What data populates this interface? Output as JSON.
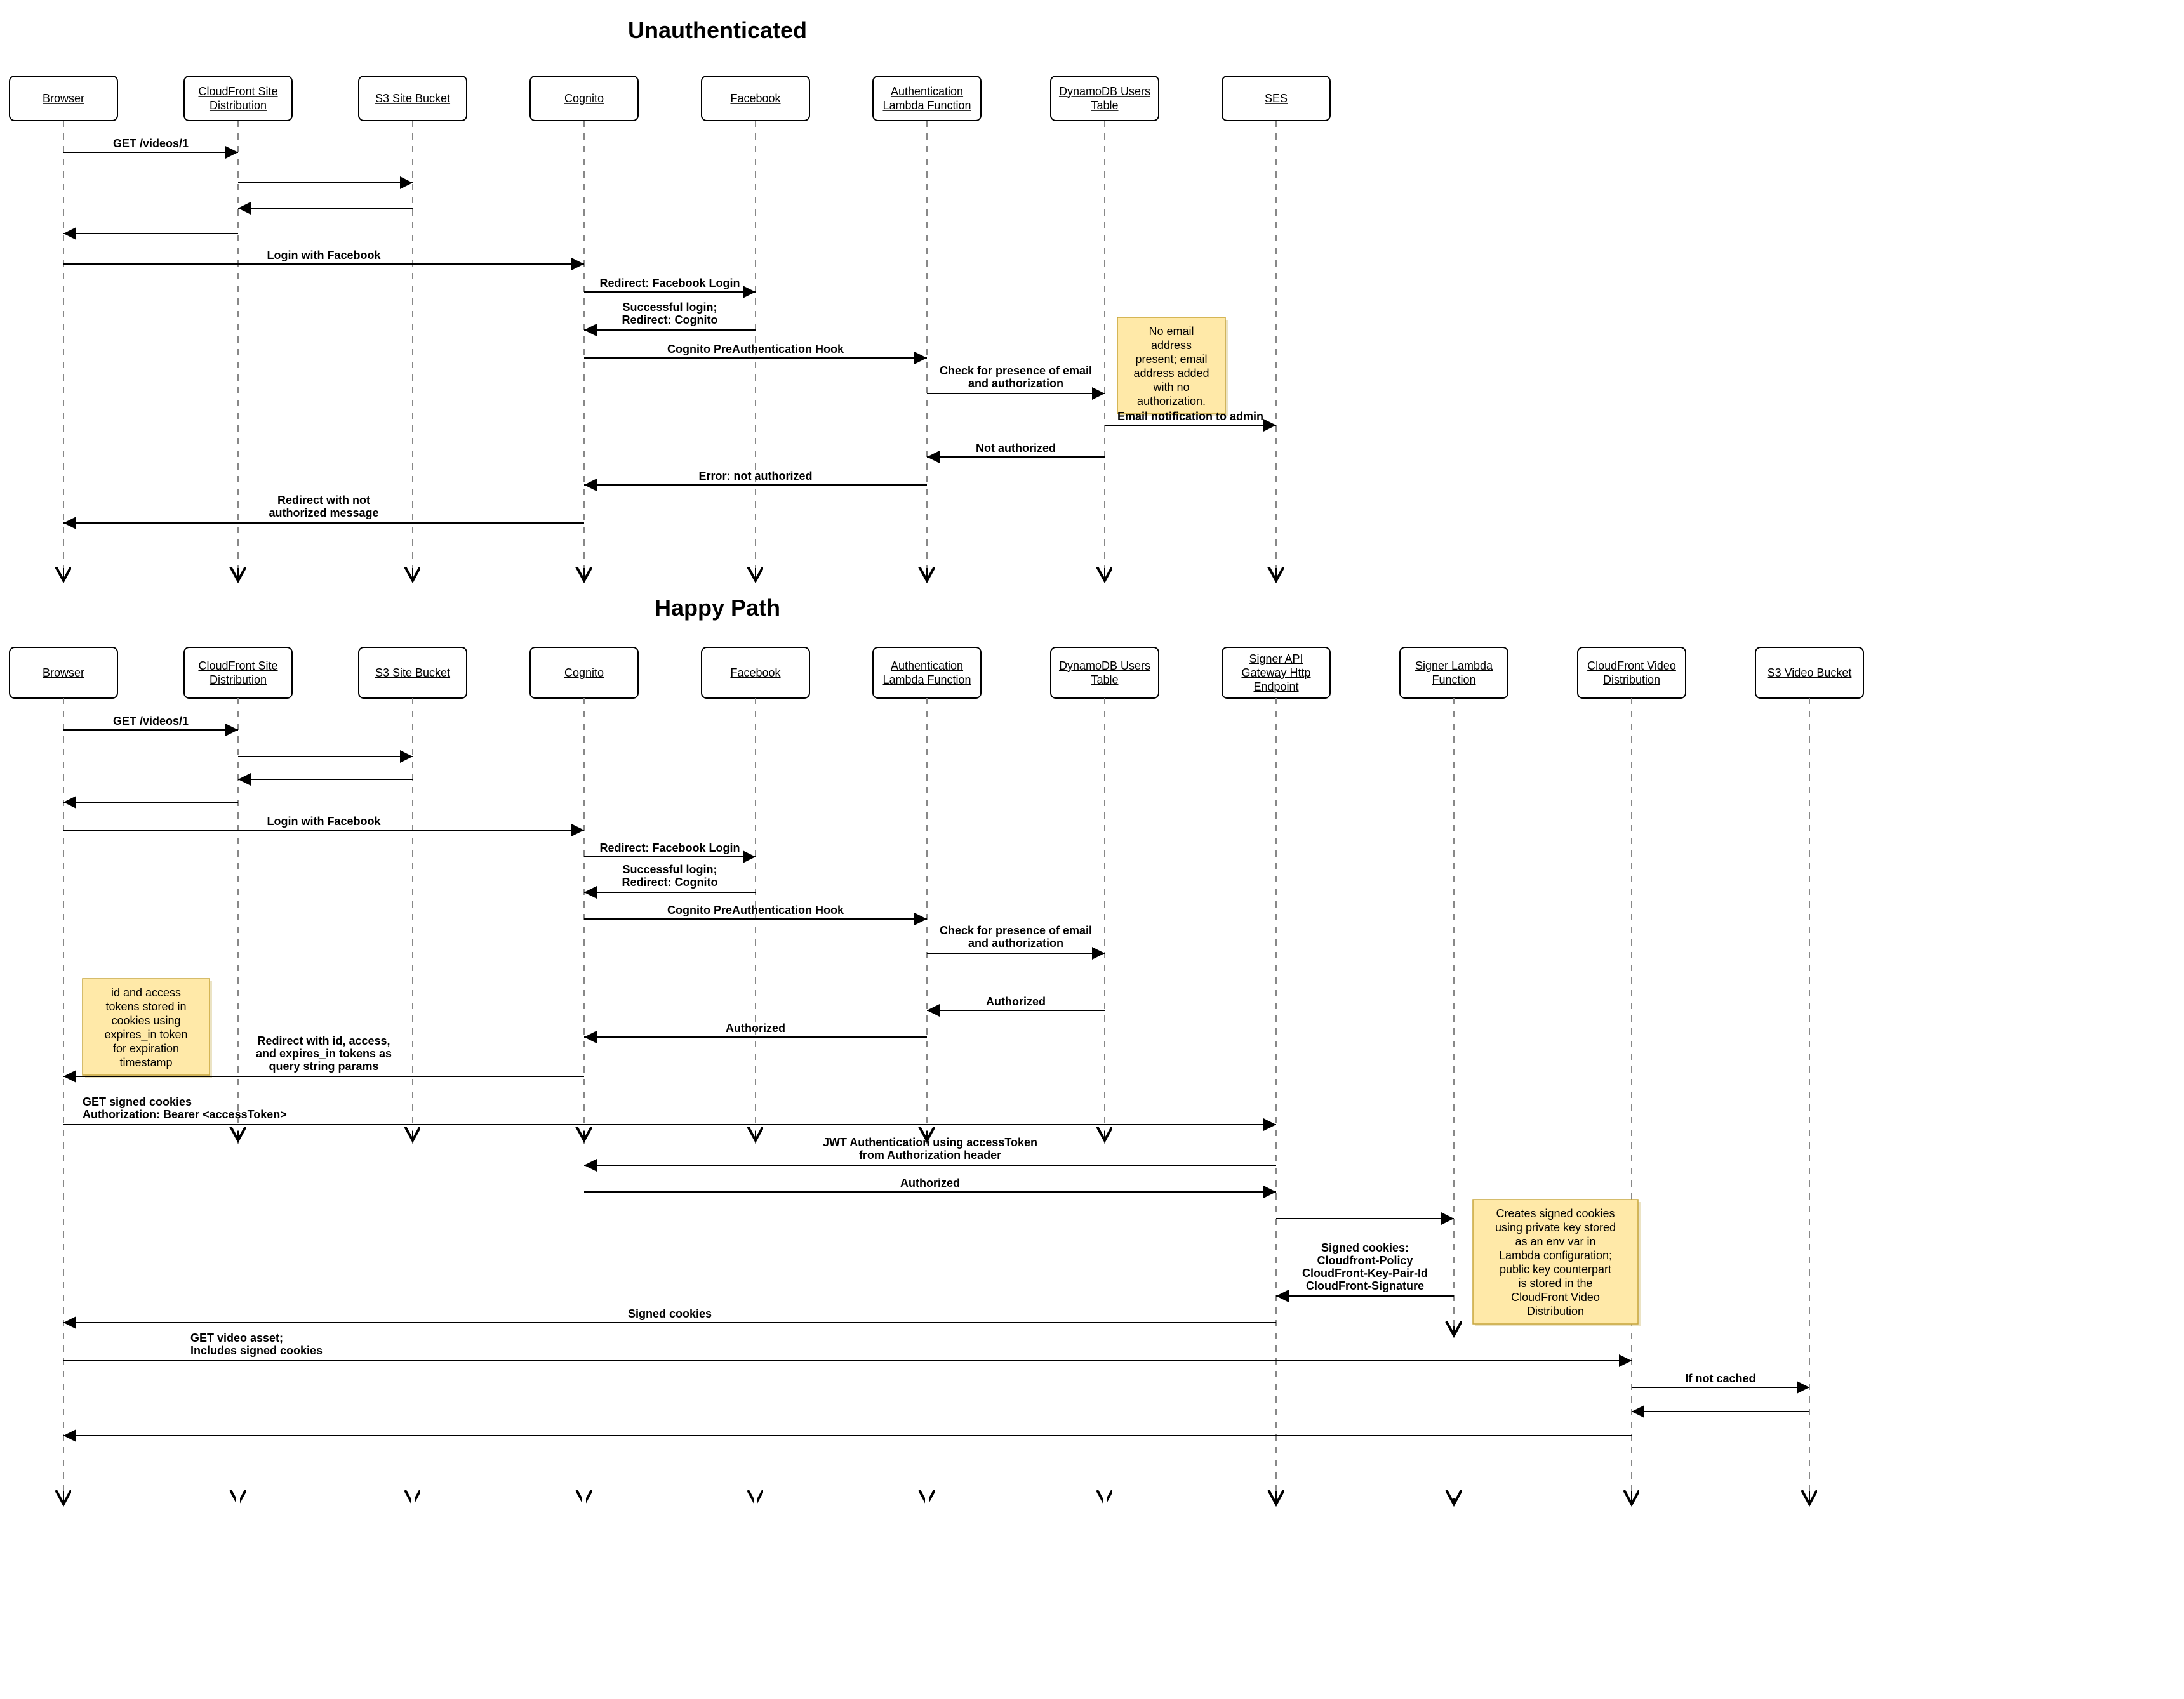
{
  "diagram1": {
    "title": "Unauthenticated",
    "actors": [
      "Browser",
      "CloudFront Site Distribution",
      "S3 Site Bucket",
      "Cognito",
      "Facebook",
      "Authentication Lambda Function",
      "DynamoDB Users Table",
      "SES"
    ],
    "messages": {
      "m1": "GET /videos/1",
      "m2": "Login with Facebook",
      "m3": "Redirect: Facebook Login",
      "m4a": "Successful login;",
      "m4b": "Redirect: Cognito",
      "m5": "Cognito PreAuthentication Hook",
      "m6a": "Check for presence of email",
      "m6b": "and authorization",
      "m7": "Email notification to admin",
      "m8": "Not authorized",
      "m9": "Error: not authorized",
      "m10a": "Redirect with not",
      "m10b": "authorized message"
    },
    "notes": {
      "n1": [
        "No email",
        "address",
        "present; email",
        "address added",
        "with no",
        "authorization."
      ]
    }
  },
  "diagram2": {
    "title": "Happy Path",
    "actors": [
      "Browser",
      "CloudFront Site Distribution",
      "S3 Site Bucket",
      "Cognito",
      "Facebook",
      "Authentication Lambda Function",
      "DynamoDB Users Table",
      "Signer API Gateway Http Endpoint",
      "Signer Lambda Function",
      "CloudFront Video Distribution",
      "S3 Video Bucket"
    ],
    "messages": {
      "m1": "GET /videos/1",
      "m2": "Login with Facebook",
      "m3": "Redirect: Facebook Login",
      "m4a": "Successful login;",
      "m4b": "Redirect: Cognito",
      "m5": "Cognito PreAuthentication Hook",
      "m6a": "Check for presence of email",
      "m6b": "and authorization",
      "m7": "Authorized",
      "m8": "Authorized",
      "m9a": "Redirect with id, access,",
      "m9b": "and expires_in tokens as",
      "m9c": "query string params",
      "m10a": "GET signed cookies",
      "m10b": "Authorization: Bearer <accessToken>",
      "m11a": "JWT Authentication using accessToken",
      "m11b": "from Authorization header",
      "m12": "Authorized",
      "m13a": "Signed cookies:",
      "m13b": "Cloudfront-Policy",
      "m13c": "CloudFront-Key-Pair-Id",
      "m13d": "CloudFront-Signature",
      "m14": "Signed cookies",
      "m15a": "GET video asset;",
      "m15b": "Includes signed cookies",
      "m16": "If not cached"
    },
    "notes": {
      "n1": [
        "id and access",
        "tokens stored in",
        "cookies using",
        "expires_in token",
        "for expiration",
        "timestamp"
      ],
      "n2": [
        "Creates signed cookies",
        "using private key stored",
        "as an env var in",
        "Lambda configuration;",
        "public key counterpart",
        "is stored in the",
        "CloudFront Video",
        "Distribution"
      ]
    }
  }
}
